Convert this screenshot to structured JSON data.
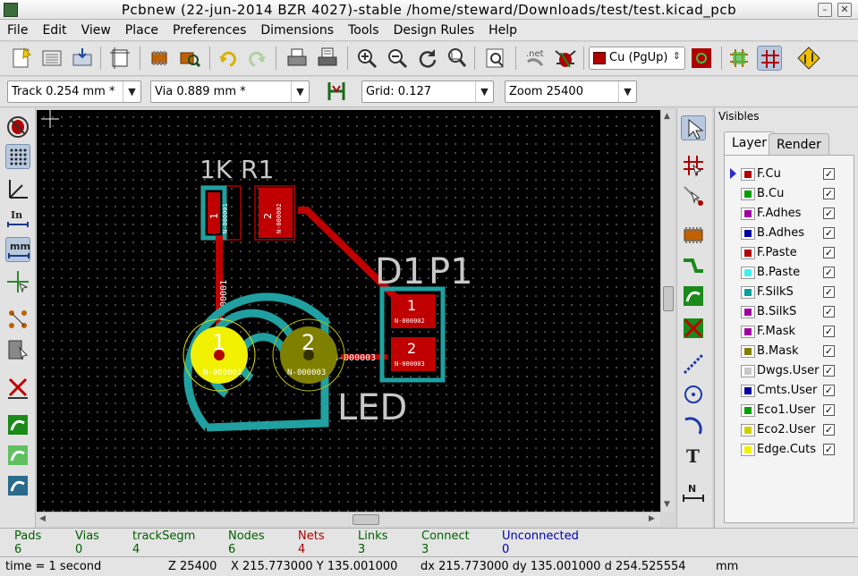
{
  "window": {
    "title": "Pcbnew (22-jun-2014 BZR 4027)-stable /home/steward/Downloads/test/test.kicad_pcb"
  },
  "menu": [
    "File",
    "Edit",
    "View",
    "Place",
    "Preferences",
    "Dimensions",
    "Tools",
    "Design Rules",
    "Help"
  ],
  "toolbar": {
    "active_layer": "Cu (PgUp)",
    "active_layer_color": "#b00000"
  },
  "toolbar2": {
    "track": "Track 0.254 mm *",
    "via": "Via 0.889 mm *",
    "grid": "Grid: 0.127",
    "zoom": "Zoom 25400"
  },
  "board": {
    "r1_value": "1K",
    "r1_ref": "R1",
    "r1_pad1": "1",
    "r1_pad2": "2",
    "r1_net1": "N-000001",
    "r1_net2": "N-000002",
    "d1_ref": "D1",
    "p1_ref": "P1",
    "p1_pad1": "1",
    "p1_pad2": "2",
    "p1_net1": "N-000002",
    "p1_net2": "N-000003",
    "led_label": "LED",
    "led_pad1": "1",
    "led_pad2": "2",
    "led_net1": "N-000001",
    "led_net2": "N-000003",
    "track_label1": "N-000001",
    "track_label2": "N-000003"
  },
  "visibles": {
    "title": "Visibles",
    "tab_layer": "Layer",
    "tab_render": "Render",
    "layers": [
      {
        "name": "F.Cu",
        "color": "#b00000",
        "checked": true,
        "current": true
      },
      {
        "name": "B.Cu",
        "color": "#00a000",
        "checked": true
      },
      {
        "name": "F.Adhes",
        "color": "#a000a0",
        "checked": true
      },
      {
        "name": "B.Adhes",
        "color": "#0000a0",
        "checked": true
      },
      {
        "name": "F.Paste",
        "color": "#b00000",
        "checked": true
      },
      {
        "name": "B.Paste",
        "color": "#40f0f0",
        "checked": true
      },
      {
        "name": "F.SilkS",
        "color": "#00a0a0",
        "checked": true
      },
      {
        "name": "B.SilkS",
        "color": "#a000a0",
        "checked": true
      },
      {
        "name": "F.Mask",
        "color": "#a000a0",
        "checked": true
      },
      {
        "name": "B.Mask",
        "color": "#808000",
        "checked": true
      },
      {
        "name": "Dwgs.User",
        "color": "#c8c8c8",
        "checked": true
      },
      {
        "name": "Cmts.User",
        "color": "#0000a0",
        "checked": true
      },
      {
        "name": "Eco1.User",
        "color": "#00a000",
        "checked": true
      },
      {
        "name": "Eco2.User",
        "color": "#d0d000",
        "checked": true
      },
      {
        "name": "Edge.Cuts",
        "color": "#f0f000",
        "checked": true
      }
    ]
  },
  "status": [
    {
      "label": "Pads",
      "value": "6",
      "color": "#006000"
    },
    {
      "label": "Vias",
      "value": "0",
      "color": "#006000"
    },
    {
      "label": "trackSegm",
      "value": "4",
      "color": "#006000"
    },
    {
      "label": "Nodes",
      "value": "6",
      "color": "#006000"
    },
    {
      "label": "Nets",
      "value": "4",
      "color": "#b00000"
    },
    {
      "label": "Links",
      "value": "3",
      "color": "#006000"
    },
    {
      "label": "Connect",
      "value": "3",
      "color": "#006000"
    },
    {
      "label": "Unconnected",
      "value": "0",
      "color": "#0000b0"
    }
  ],
  "bottom": {
    "time": "time = 1 second",
    "zoom": "Z 25400",
    "xy": "X 215.773000  Y 135.001000",
    "dxy": "dx 215.773000  dy 135.001000  d 254.525554",
    "units": "mm"
  }
}
